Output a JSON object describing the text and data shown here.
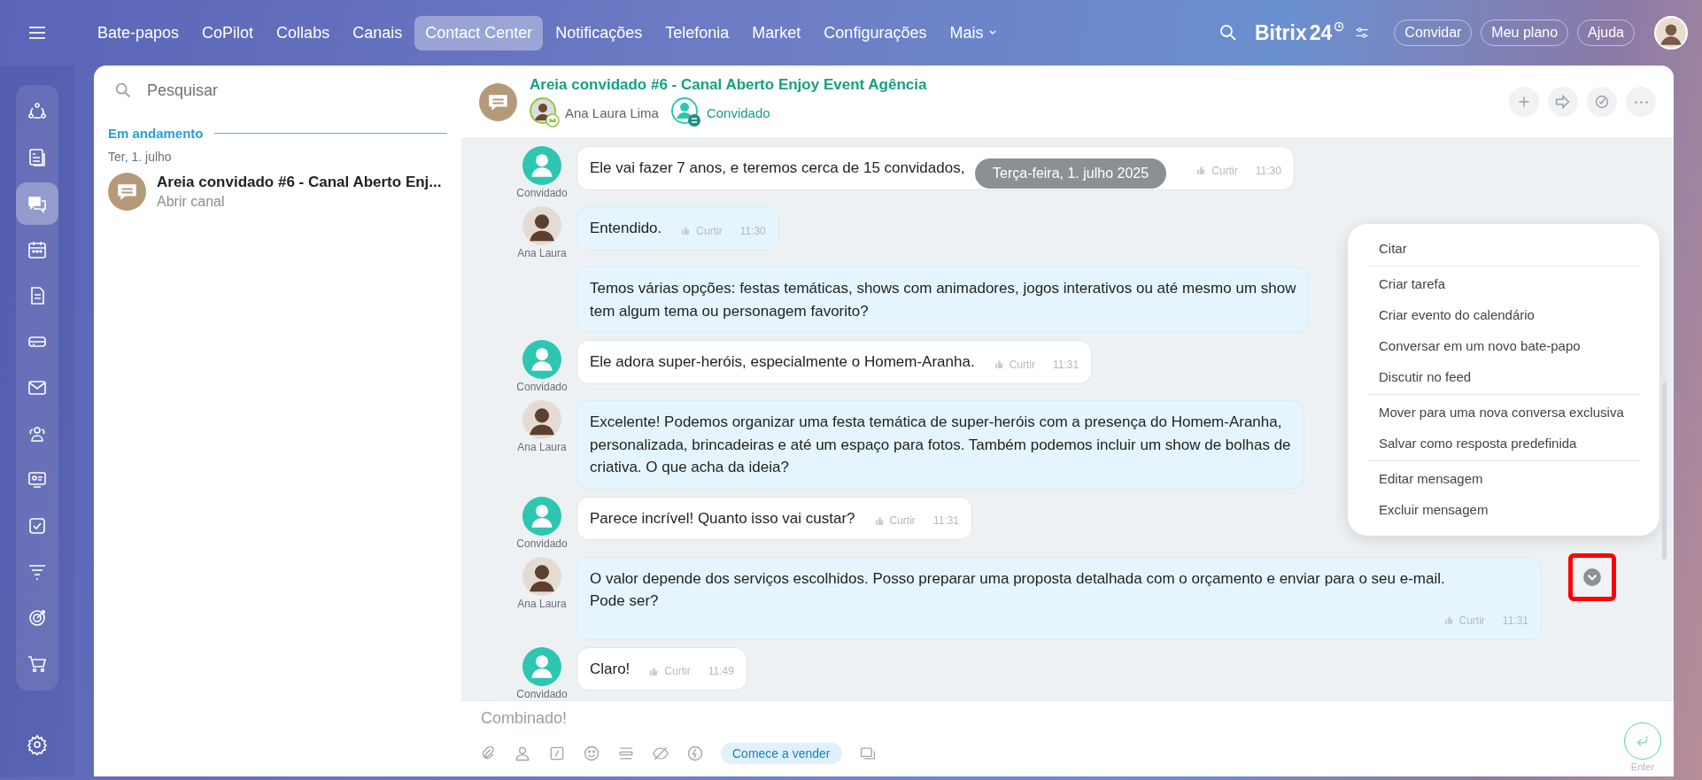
{
  "top_nav": {
    "tabs": [
      {
        "label": "Bate-papos",
        "selected": false,
        "kind": "link"
      },
      {
        "label": "CoPilot",
        "selected": false,
        "kind": "link"
      },
      {
        "label": "Collabs",
        "selected": false,
        "kind": "link"
      },
      {
        "label": "Canais",
        "selected": false,
        "kind": "link"
      },
      {
        "label": "Contact Center",
        "selected": true,
        "kind": "link"
      },
      {
        "label": "Notificações",
        "selected": false,
        "kind": "link"
      },
      {
        "label": "Telefonia",
        "selected": false,
        "kind": "link"
      },
      {
        "label": "Market",
        "selected": false,
        "kind": "link"
      },
      {
        "label": "Configurações",
        "selected": false,
        "kind": "link"
      },
      {
        "label": "Mais",
        "selected": false,
        "kind": "dropdown"
      }
    ],
    "logo": {
      "name": "Bitrix",
      "number": "24"
    },
    "buttons": [
      "Convidar",
      "Meu plano",
      "Ajuda"
    ]
  },
  "rail": {
    "items": [
      {
        "selected": false
      },
      {
        "selected": false
      },
      {
        "selected": true
      },
      {
        "selected": false
      },
      {
        "selected": false
      },
      {
        "selected": false
      },
      {
        "selected": false
      },
      {
        "selected": false
      },
      {
        "selected": false
      },
      {
        "selected": false
      },
      {
        "selected": false
      },
      {
        "selected": false
      },
      {
        "selected": false
      },
      {
        "selected": false
      }
    ]
  },
  "chat_list": {
    "search": {
      "placeholder": "Pesquisar"
    },
    "section": "Em andamento",
    "date": "Ter, 1. julho",
    "items": [
      {
        "title": "Areia convidado #6 - Canal Aberto Enj...",
        "subtitle": "Abrir canal"
      }
    ]
  },
  "chat": {
    "title": "Areia convidado #6 - Canal Aberto Enjoy Event Agência",
    "members": [
      {
        "name": "Ana Laura Lima",
        "kind": "agent"
      },
      {
        "name": "Convidado",
        "kind": "guest"
      }
    ],
    "date_divider": "Terça-feira, 1. julho 2025",
    "messages": [
      {
        "kind": "guest",
        "author": "Convidado",
        "text": "Ele vai fazer 7 anos, e teremos cerca de 15 convidados,",
        "like": "Curtir",
        "time": "11:30",
        "menu_open": false
      },
      {
        "kind": "agent",
        "author": "Ana Laura",
        "text": "Entendido.",
        "like": "Curtir",
        "time": "11:30",
        "menu_open": false
      },
      {
        "kind": "agent",
        "text": "Temos várias opções: festas temáticas, shows com animadores, jogos interativos ou até mesmo um show\ntem algum tema ou personagem favorito?",
        "menu_open": false
      },
      {
        "kind": "guest",
        "author": "Convidado",
        "text": "Ele adora super-heróis, especialmente o Homem-Aranha.",
        "like": "Curtir",
        "time": "11:31",
        "menu_open": false
      },
      {
        "kind": "agent",
        "author": "Ana Laura",
        "text": "Excelente! Podemos organizar uma festa temática de super-heróis com a presença do Homem-Aranha,\npersonalizada, brincadeiras e até um espaço para fotos. Também podemos incluir um show de bolhas de\ncriativa. O que acha da ideia?",
        "menu_open": false
      },
      {
        "kind": "guest",
        "author": "Convidado",
        "text": "Parece incrível! Quanto isso vai custar?",
        "like": "Curtir",
        "time": "11:31",
        "menu_open": false
      },
      {
        "kind": "agent",
        "author": "Ana Laura",
        "text": "O valor depende dos serviços escolhidos. Posso preparar uma proposta detalhada com o orçamento e enviar para o seu e-mail.\nPode ser?",
        "like": "Curtir",
        "time": "11:31",
        "menu_open": true
      },
      {
        "kind": "guest",
        "author": "Convidado",
        "text": "Claro!",
        "like": "Curtir",
        "time": "11:49",
        "menu_open": false
      }
    ],
    "context_menu": {
      "groups": [
        [
          "Citar"
        ],
        [
          "Criar tarefa",
          "Criar evento do calendário",
          "Conversar em um novo bate-papo",
          "Discutir no feed"
        ],
        [
          "Mover para uma nova conversa exclusiva",
          "Salvar como resposta predefinida"
        ],
        [
          "Editar mensagem",
          "Excluir mensagem"
        ]
      ]
    }
  },
  "composer": {
    "placeholder": "Combinado!",
    "chip": "Comece a vender",
    "send_hint": "Enter"
  }
}
